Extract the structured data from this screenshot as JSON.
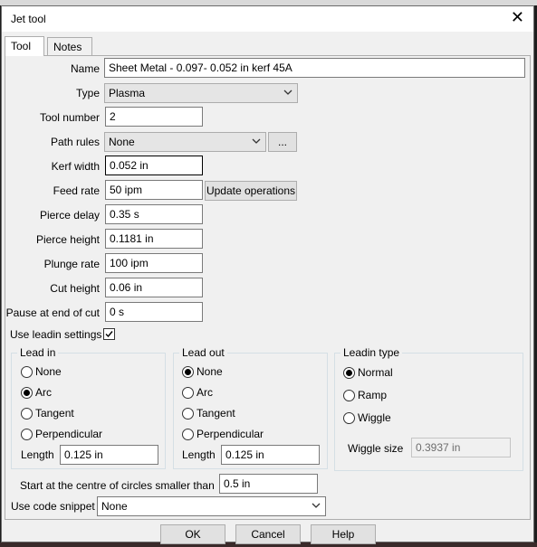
{
  "window": {
    "title": "Jet tool"
  },
  "tabs": [
    "Tool",
    "Notes"
  ],
  "fields": {
    "name": {
      "label": "Name",
      "value": "Sheet Metal - 0.097- 0.052 in kerf 45A"
    },
    "type": {
      "label": "Type",
      "value": "Plasma"
    },
    "tool_number": {
      "label": "Tool number",
      "value": "2"
    },
    "path_rules": {
      "label": "Path rules",
      "value": "None",
      "browse": "..."
    },
    "kerf_width": {
      "label": "Kerf width",
      "value": "0.052 in"
    },
    "feed_rate": {
      "label": "Feed rate",
      "value": "50 ipm",
      "button": "Update operations"
    },
    "pierce_delay": {
      "label": "Pierce delay",
      "value": "0.35 s"
    },
    "pierce_height": {
      "label": "Pierce height",
      "value": "0.1181 in"
    },
    "plunge_rate": {
      "label": "Plunge rate",
      "value": "100 ipm"
    },
    "cut_height": {
      "label": "Cut height",
      "value": "0.06 in"
    },
    "pause_end": {
      "label": "Pause at end of cut",
      "value": "0 s"
    }
  },
  "use_leadin": {
    "label": "Use leadin settings",
    "checked": true
  },
  "lead_in": {
    "title": "Lead in",
    "options": [
      "None",
      "Arc",
      "Tangent",
      "Perpendicular"
    ],
    "selected": "Arc",
    "length_label": "Length",
    "length_value": "0.125 in"
  },
  "lead_out": {
    "title": "Lead out",
    "options": [
      "None",
      "Arc",
      "Tangent",
      "Perpendicular"
    ],
    "selected": "None",
    "length_label": "Length",
    "length_value": "0.125 in"
  },
  "leadin_type": {
    "title": "Leadin type",
    "options": [
      "Normal",
      "Ramp",
      "Wiggle"
    ],
    "selected": "Normal",
    "wiggle_label": "Wiggle size",
    "wiggle_value": "0.3937 in"
  },
  "start_centre": {
    "label": "Start at the centre of circles smaller than",
    "value": "0.5 in"
  },
  "code_snippet": {
    "label": "Use code snippet",
    "value": "None"
  },
  "buttons": {
    "ok": "OK",
    "cancel": "Cancel",
    "help": "Help"
  }
}
